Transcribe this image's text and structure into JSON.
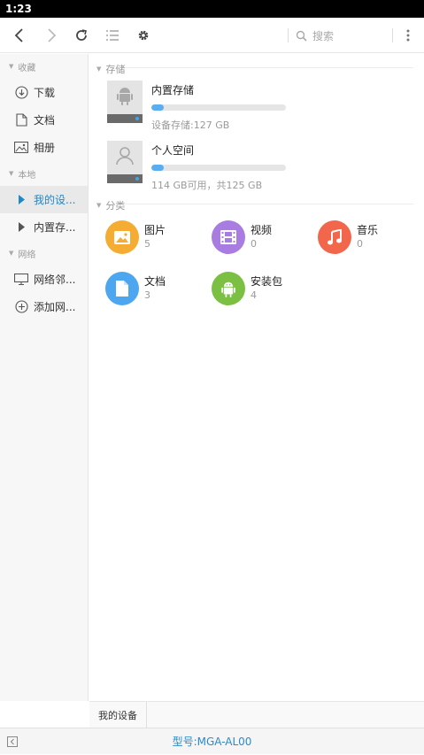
{
  "status": {
    "time": "1:23"
  },
  "toolbar": {
    "search_placeholder": "搜索",
    "icons": [
      "back-arrow-icon",
      "forward-arrow-icon",
      "refresh-icon",
      "list-view-icon",
      "settings-gear-icon",
      "more-vertical-icon"
    ]
  },
  "sidebar": {
    "groups": [
      {
        "label": "收藏",
        "items": [
          {
            "label": "下载",
            "icon": "download-icon"
          },
          {
            "label": "文档",
            "icon": "document-icon"
          },
          {
            "label": "相册",
            "icon": "picture-icon"
          }
        ]
      },
      {
        "label": "本地",
        "items": [
          {
            "label": "我的设...",
            "icon": "triangle-right-icon",
            "active": true
          },
          {
            "label": "内置存...",
            "icon": "triangle-right-icon"
          }
        ]
      },
      {
        "label": "网络",
        "items": [
          {
            "label": "网络邻...",
            "icon": "network-monitor-icon"
          },
          {
            "label": "添加网...",
            "icon": "add-circle-icon"
          }
        ]
      }
    ]
  },
  "main": {
    "storage_header": "存储",
    "storages": [
      {
        "title": "内置存储",
        "meta": "设备存储:127 GB",
        "usage_fraction": 0.09,
        "icon": "android-storage-icon"
      },
      {
        "title": "个人空间",
        "meta": "114 GB可用，共125 GB",
        "usage_fraction": 0.09,
        "icon": "person-storage-icon"
      }
    ],
    "category_header": "分类",
    "categories": [
      {
        "name": "图片",
        "count": "5",
        "color": "#f5ac33",
        "icon": "image-icon"
      },
      {
        "name": "视频",
        "count": "0",
        "color": "#a87ce0",
        "icon": "video-film-icon"
      },
      {
        "name": "音乐",
        "count": "0",
        "color": "#f2674c",
        "icon": "music-note-icon"
      },
      {
        "name": "文档",
        "count": "3",
        "color": "#4da6f0",
        "icon": "document-icon"
      },
      {
        "name": "安装包",
        "count": "4",
        "color": "#7bc043",
        "icon": "android-apk-icon"
      }
    ]
  },
  "pathbar": {
    "crumb": "我的设备"
  },
  "bottombar": {
    "model": "型号:MGA-AL00"
  }
}
